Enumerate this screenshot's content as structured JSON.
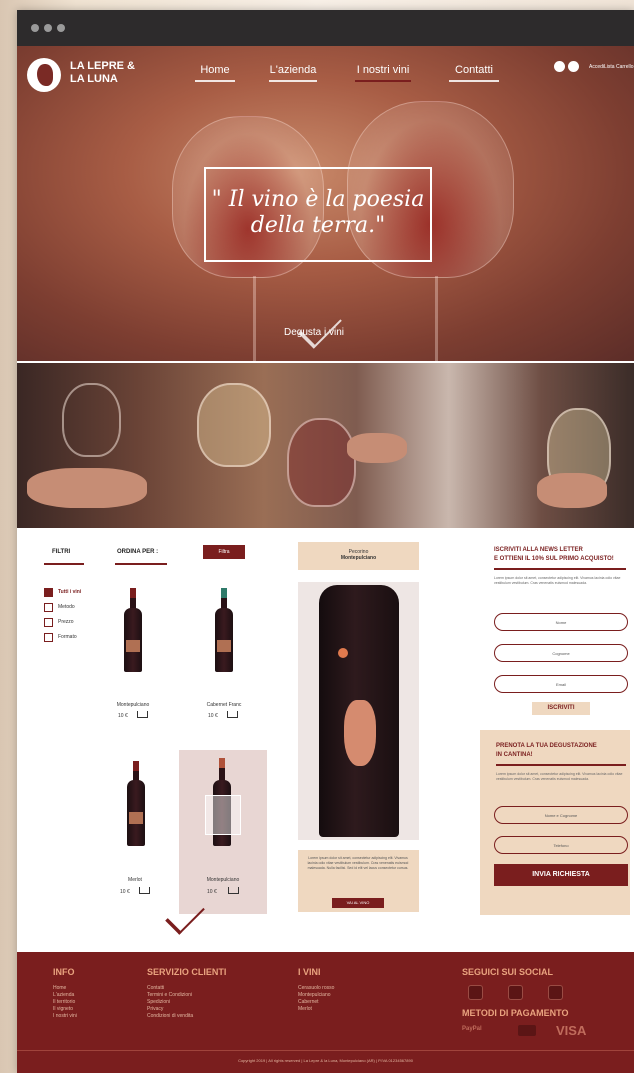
{
  "brand": {
    "line1": "LA LEPRE &",
    "line2": "LA LUNA"
  },
  "nav": {
    "home": "Home",
    "azienda": "L'azienda",
    "vini": "I nostri vini",
    "contatti": "Contatti"
  },
  "util": {
    "a": "Accedi",
    "b": "Lista",
    "c": "Carrello"
  },
  "hero": {
    "quote_line1": "\" Il vino è la poesia",
    "quote_line2": "della terra.\"",
    "cta": "Degusta i vini"
  },
  "shop": {
    "filtri": "FILTRI",
    "ordina": "ORDINA PER :",
    "filter_button": "Filtra",
    "filters": [
      "Tutti i vini",
      "Metodo",
      "Prezzo",
      "Formato"
    ],
    "products": [
      {
        "name": "Montepulciano",
        "price": "10 €"
      },
      {
        "name": "Cabernet Franc",
        "price": "10 €"
      },
      {
        "name": "Merlot",
        "price": "10 €"
      },
      {
        "name": "Montepulciano",
        "price": "10 €"
      }
    ]
  },
  "detail": {
    "head1": "Pecorino",
    "head2": "Montepulciano",
    "desc": "Lorem ipsum dolor sit amet, consectetur adipiscing elit. Vivamus lacinia odio vitae vestibulum vestibulum. Cras venenatis euismod malesuada. Nulla facilisi. Sed id elit vel lacus consectetur cursus.",
    "button": "VAI AL VINO"
  },
  "newsletter": {
    "title1": "ISCRIVITI ALLA NEWS LETTER",
    "title2": "E OTTIENI IL 10% SUL PRIMO ACQUISTO!",
    "text": "Lorem ipsum dolor sit amet, consectetur adipiscing elit. Vivamus lacinia odio vitae vestibulum vestibulum. Cras venenatis euismod malesuada.",
    "fields": [
      "Nome",
      "Cognome",
      "Email"
    ],
    "button": "ISCRIVITI"
  },
  "booking": {
    "title1": "PRENOTA LA TUA DEGUSTAZIONE",
    "title2": "IN CANTINA!",
    "text": "Lorem ipsum dolor sit amet, consectetur adipiscing elit. Vivamus lacinia odio vitae vestibulum vestibulum. Cras venenatis euismod malesuada.",
    "fields": [
      "Nome e Cognome",
      "Telefono"
    ],
    "button": "INVIA RICHIESTA"
  },
  "footer": {
    "info": {
      "title": "INFO",
      "items": [
        "Home",
        "L'azienda",
        "Il territorio",
        "Il vigneto",
        "I nostri vini"
      ]
    },
    "servizio": {
      "title": "SERVIZIO CLIENTI",
      "items": [
        "Contatti",
        "Termini e Condizioni",
        "Spedizioni",
        "Privacy",
        "Condizioni di vendita"
      ]
    },
    "vini": {
      "title": "I VINI",
      "items": [
        "Cerasuolo rosso",
        "Montepulciano",
        "Cabernet",
        "Merlot"
      ]
    },
    "social_title": "SEGUICI SUI SOCIAL",
    "pay_title": "METODI DI PAGAMENTO",
    "pay": [
      "PayPal",
      "VISA"
    ],
    "copyright": "Copyright 2019 | All rights reserved | La Lepre & la Luna, Montepulciano (AR) | P.IVA 01234567890"
  }
}
